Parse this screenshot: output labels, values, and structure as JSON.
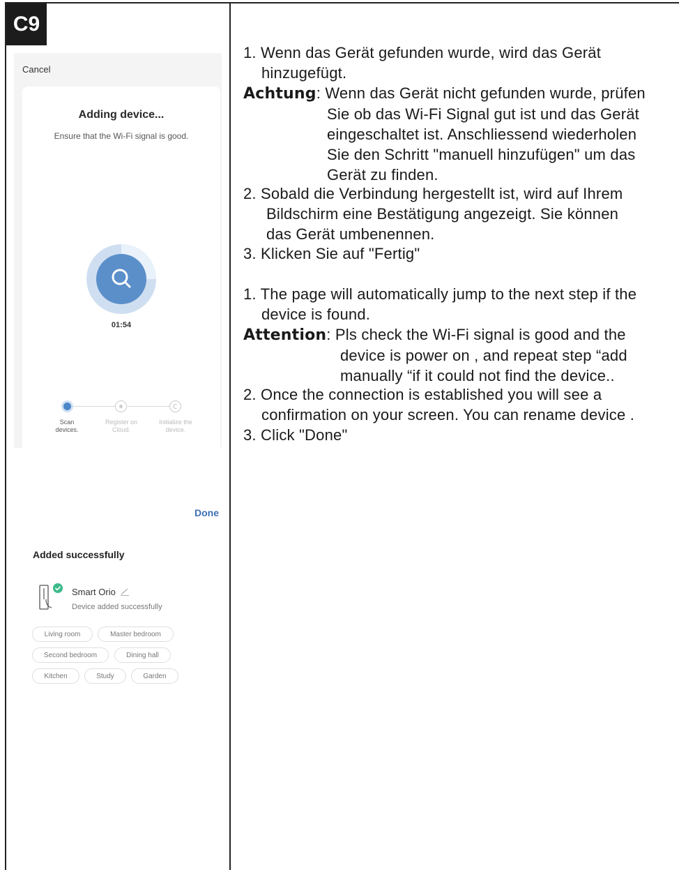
{
  "badge": "C9",
  "screen1": {
    "cancel_label": "Cancel",
    "title": "Adding device...",
    "subtitle": "Ensure that the Wi-Fi signal is good.",
    "timer": "01:54",
    "steps": [
      {
        "line1": "Scan",
        "line2": "devices.",
        "state": "active"
      },
      {
        "line1": "Register on",
        "line2": "Cloud.",
        "state": "pending"
      },
      {
        "line1": "Initialize the",
        "line2": "device.",
        "state": "pending"
      }
    ],
    "accent_color": "#4a86c8"
  },
  "screen2": {
    "done_label": "Done",
    "title": "Added successfully",
    "device_name": "Smart Orio",
    "device_status": "Device added successfully",
    "rooms": [
      "Living room",
      "Master bedroom",
      "Second bedroom",
      "Dining hall",
      "Kitchen",
      "Study",
      "Garden"
    ],
    "success_color": "#3dbb8a"
  },
  "german": {
    "item1_line1": "1. Wenn das Gerät gefunden wurde, wird das Gerät",
    "item1_line2": "hinzugefügt.",
    "note_label": "Achtung",
    "note_line1": ": Wenn das Gerät nicht gefunden wurde, prüfen",
    "note_line2": "Sie ob das Wi-Fi Signal gut ist und das Gerät",
    "note_line3": "eingeschaltet ist. Anschliessend wiederholen",
    "note_line4": "Sie den Schritt \"manuell hinzufügen\" um das",
    "note_line5": "Gerät zu finden.",
    "item2_line1": "2.  Sobald die Verbindung hergestellt ist, wird auf Ihrem",
    "item2_line2": "Bildschirm eine Bestätigung angezeigt. Sie können",
    "item2_line3": "das Gerät umbenennen.",
    "item3": "3.  Klicken Sie auf \"Fertig\""
  },
  "english": {
    "item1_line1": "1. The page will automatically jump to the next step if the",
    "item1_line2": "device is found.",
    "note_label": "Attention",
    "note_line1": ": Pls check the Wi-Fi signal is good and the",
    "note_line2": "device is power on , and repeat step “add",
    "note_line3": "manually “if it could not find the device..",
    "item2_line1": "2. Once the connection is established you will see a",
    "item2_line2": "confirmation on your screen. You can rename device .",
    "item3": "3. Click \"Done\""
  }
}
